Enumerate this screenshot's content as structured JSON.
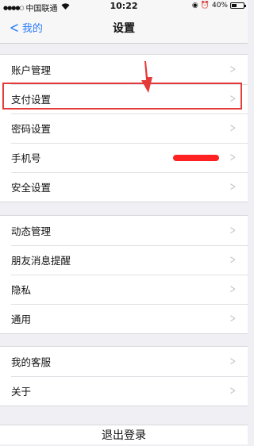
{
  "status_bar": {
    "carrier": "中国联通",
    "time": "10:22",
    "battery": "40%",
    "battery_level": 0.4,
    "icons": [
      "signal-dots-icon",
      "wifi-icon",
      "orientation-lock-icon",
      "alarm-icon",
      "battery-icon"
    ]
  },
  "nav": {
    "back_label": "我的",
    "title": "设置"
  },
  "groups": [
    {
      "items": [
        {
          "label": "账户管理"
        },
        {
          "label": "支付设置"
        },
        {
          "label": "密码设置"
        },
        {
          "label": "手机号"
        },
        {
          "label": "安全设置"
        }
      ]
    },
    {
      "items": [
        {
          "label": "动态管理"
        },
        {
          "label": "朋友消息提醒"
        },
        {
          "label": "隐私"
        },
        {
          "label": "通用"
        }
      ]
    },
    {
      "items": [
        {
          "label": "我的客服"
        },
        {
          "label": "关于"
        }
      ]
    }
  ],
  "logout_label": "退出登录",
  "colors": {
    "accent": "#2b7cf6",
    "annotation_red": "#e53a3a",
    "background": "#efeff4"
  }
}
